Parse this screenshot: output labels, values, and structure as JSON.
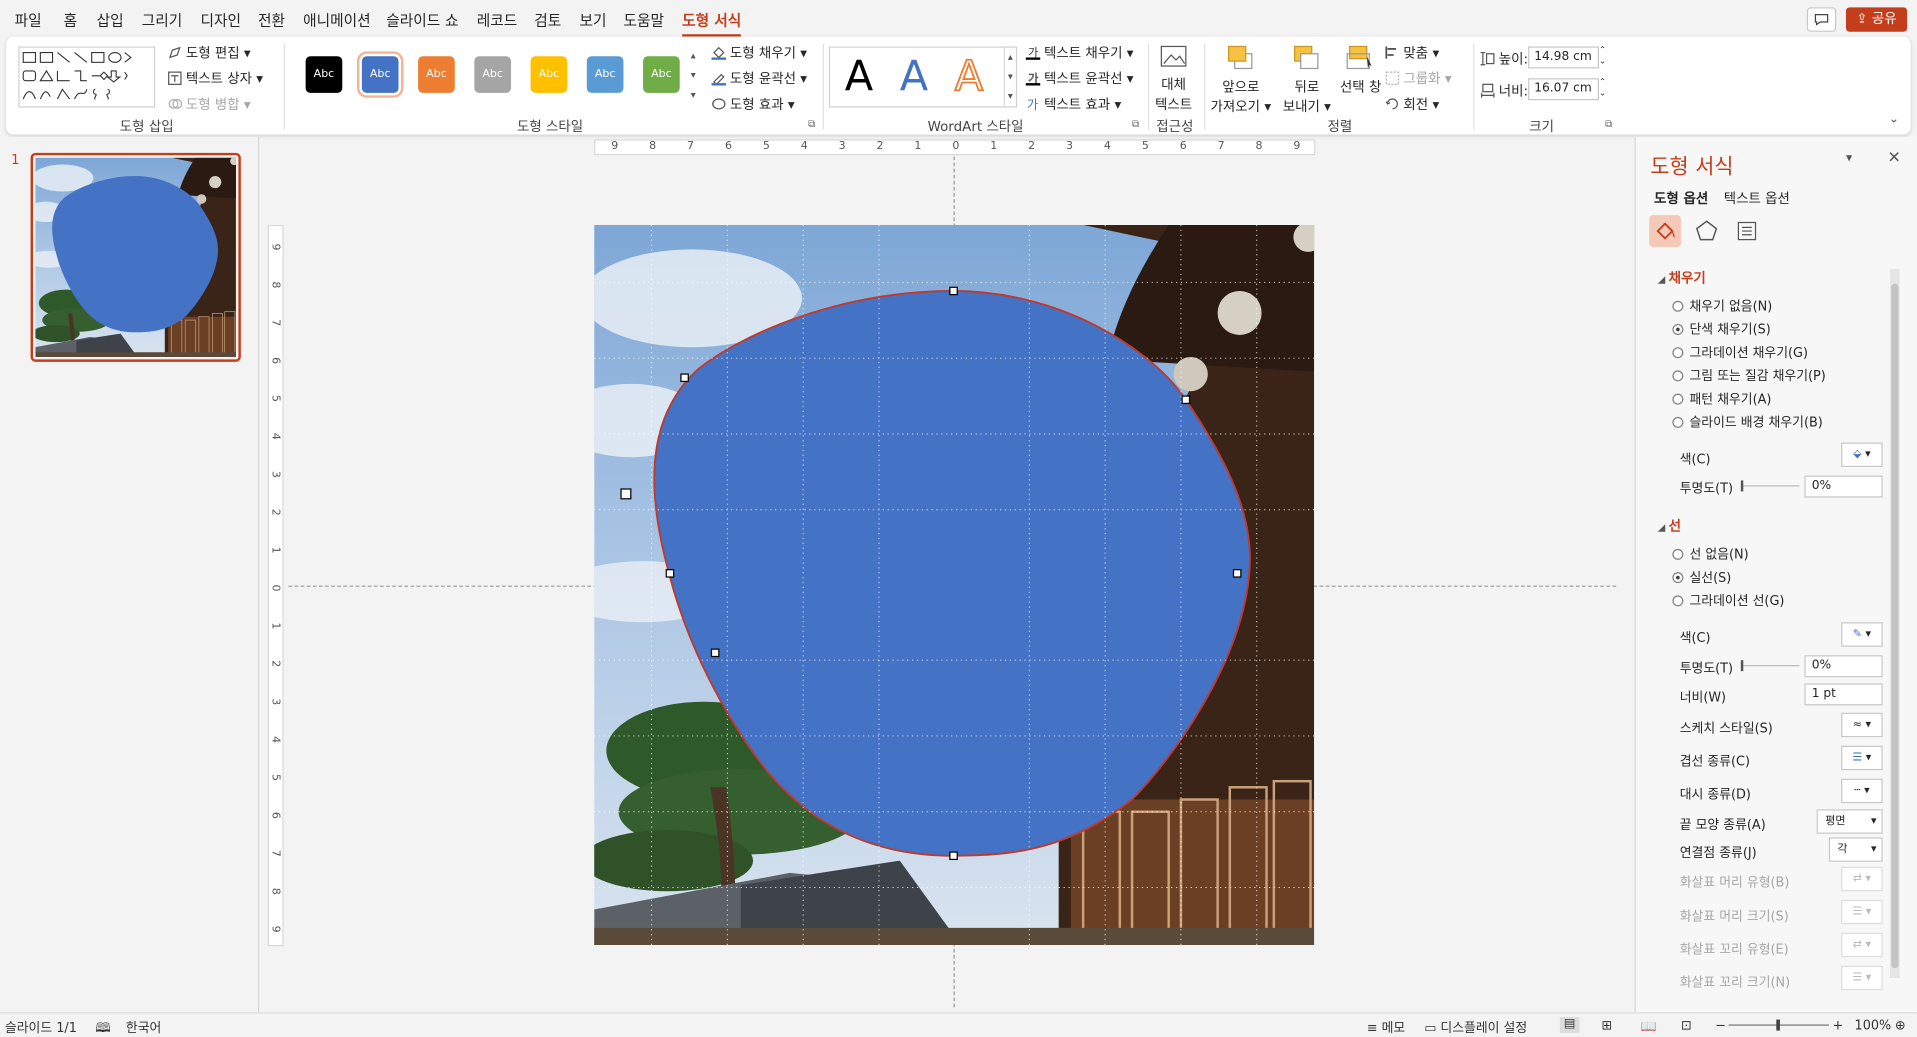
{
  "menu": {
    "items": [
      "파일",
      "홈",
      "삽입",
      "그리기",
      "디자인",
      "전환",
      "애니메이션",
      "슬라이드 쇼",
      "레코드",
      "검토",
      "보기",
      "도움말",
      "도형 서식"
    ],
    "active_index": 12,
    "share_label": "공유",
    "comment_icon": "comment-icon"
  },
  "ribbon": {
    "insert_shapes": {
      "label": "도형 삽입",
      "edit_shape": "도형 편집",
      "text_box": "텍스트 상자",
      "merge_shapes": "도형 병합"
    },
    "shape_styles": {
      "label": "도형 스타일",
      "tile_text": "Abc",
      "tile_colors": [
        "#000000",
        "#4472c4",
        "#ed7d31",
        "#a5a5a5",
        "#ffc000",
        "#5b9bd5",
        "#70ad47"
      ],
      "selected_index": 1,
      "shape_fill": "도형 채우기",
      "shape_outline": "도형 윤곽선",
      "shape_effects": "도형 효과"
    },
    "wordart": {
      "label": "WordArt 스타일",
      "letter": "A",
      "letter_colors": [
        "#000000",
        "#4472c4",
        "#ed7d31"
      ],
      "text_fill": "텍스트 채우기",
      "text_outline": "텍스트 윤곽선",
      "text_effects": "텍스트 효과"
    },
    "accessibility": {
      "label": "접근성",
      "alt_text_line1": "대체",
      "alt_text_line2": "텍스트"
    },
    "arrange": {
      "label": "정렬",
      "bring_forward_1": "앞으로",
      "bring_forward_2": "가져오기",
      "send_backward_1": "뒤로",
      "send_backward_2": "보내기",
      "selection_pane": "선택 창",
      "align": "맞춤",
      "group": "그룹화",
      "rotate": "회전"
    },
    "size": {
      "label": "크기",
      "height_label": "높이:",
      "height_value": "14.98 cm",
      "width_label": "너비:",
      "width_value": "16.07 cm"
    }
  },
  "thumbnails": [
    {
      "number": "1"
    }
  ],
  "rulers": {
    "horizontal_ticks": [
      "9",
      "8",
      "7",
      "6",
      "5",
      "4",
      "3",
      "2",
      "1",
      "0",
      "1",
      "2",
      "3",
      "4",
      "5",
      "6",
      "7",
      "8",
      "9"
    ],
    "vertical_ticks": [
      "9",
      "8",
      "7",
      "6",
      "5",
      "4",
      "3",
      "2",
      "1",
      "0",
      "1",
      "2",
      "3",
      "4",
      "5",
      "6",
      "7",
      "8",
      "9"
    ]
  },
  "shape": {
    "fill_color": "#4472c4",
    "outline_color": "#c0392b"
  },
  "format_pane": {
    "title": "도형 서식",
    "tab_shape_options": "도형 옵션",
    "tab_text_options": "텍스트 옵션",
    "fill_section": "채우기",
    "fill_options": [
      {
        "label": "채우기 없음(N)",
        "selected": false
      },
      {
        "label": "단색 채우기(S)",
        "selected": true
      },
      {
        "label": "그라데이션 채우기(G)",
        "selected": false
      },
      {
        "label": "그림 또는 질감 채우기(P)",
        "selected": false
      },
      {
        "label": "패턴 채우기(A)",
        "selected": false
      },
      {
        "label": "슬라이드 배경 채우기(B)",
        "selected": false
      }
    ],
    "fill_color_label": "색(C)",
    "fill_transparency_label": "투명도(T)",
    "fill_transparency_value": "0%",
    "line_section": "선",
    "line_options": [
      {
        "label": "선 없음(N)",
        "selected": false
      },
      {
        "label": "실선(S)",
        "selected": true
      },
      {
        "label": "그라데이션 선(G)",
        "selected": false
      }
    ],
    "line_color_label": "색(C)",
    "line_transparency_label": "투명도(T)",
    "line_transparency_value": "0%",
    "width_label": "너비(W)",
    "width_value": "1 pt",
    "sketch_style_label": "스케치 스타일(S)",
    "compound_type_label": "겹선 종류(C)",
    "dash_type_label": "대시 종류(D)",
    "cap_type_label": "끝 모양 종류(A)",
    "cap_type_value": "평면",
    "join_type_label": "연결점 종류(J)",
    "join_type_value": "각",
    "begin_arrow_type_label": "화살표 머리 유형(B)",
    "begin_arrow_size_label": "화살표 머리 크기(S)",
    "end_arrow_type_label": "화살표 꼬리 유형(E)",
    "end_arrow_size_label": "화살표 꼬리 크기(N)"
  },
  "status": {
    "slide_counter": "슬라이드 1/1",
    "language": "한국어",
    "notes": "메모",
    "display_settings": "디스플레이 설정",
    "zoom": "100%"
  }
}
